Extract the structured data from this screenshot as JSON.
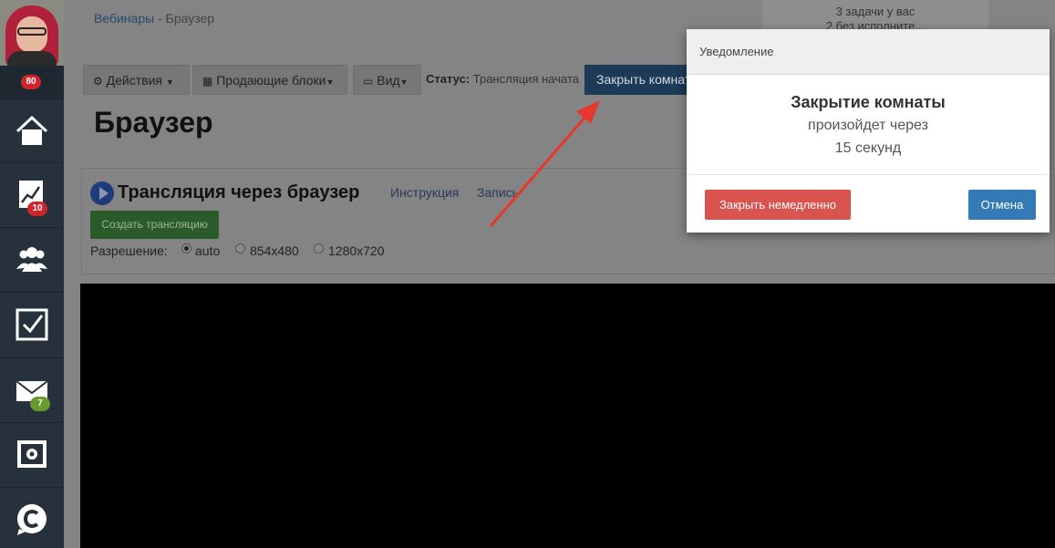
{
  "sidebar": {
    "user_badge": "80",
    "items": [
      {
        "icon": "home-icon",
        "badge": ""
      },
      {
        "icon": "chart-icon",
        "badge": "10"
      },
      {
        "icon": "users-icon",
        "badge": ""
      },
      {
        "icon": "checkbox-icon",
        "badge": ""
      },
      {
        "icon": "mail-icon",
        "badge": "7"
      },
      {
        "icon": "safe-icon",
        "badge": ""
      },
      {
        "icon": "chat-logo-icon",
        "badge": ""
      }
    ],
    "badge_colors": {
      "red": "#d0242b",
      "green": "#6a9a2c"
    }
  },
  "breadcrumb": {
    "parent": "Вебинары",
    "separator": " - ",
    "current": "Браузер"
  },
  "tasks": {
    "line1": "3 задачи у вас",
    "line2": "2 без исполните..."
  },
  "toolbar": {
    "actions_label": "Действия",
    "blocks_label": "Продающие блоки",
    "view_label": "Вид",
    "status_key": "Статус:",
    "status_value": "Трансляция начата",
    "close_room_label": "Закрыть комнату"
  },
  "page_title": "Браузер",
  "panel": {
    "title": "Трансляция через браузер",
    "link_instruction": "Инструкция",
    "link_record": "Запись",
    "create_button": "Создать трансляцию",
    "resolution_label": "Разрешение:",
    "resolutions": [
      "auto",
      "854x480",
      "1280x720"
    ],
    "selected_resolution": "auto"
  },
  "modal": {
    "header": "Уведомление",
    "title": "Закрытие комнаты",
    "line1": "произойдет через",
    "line2": "15 секунд",
    "close_now_label": "Закрыть немедленно",
    "cancel_label": "Отмена"
  },
  "colors": {
    "arrow": "#e8372c",
    "danger": "#d9534f",
    "primary": "#337ab7"
  }
}
